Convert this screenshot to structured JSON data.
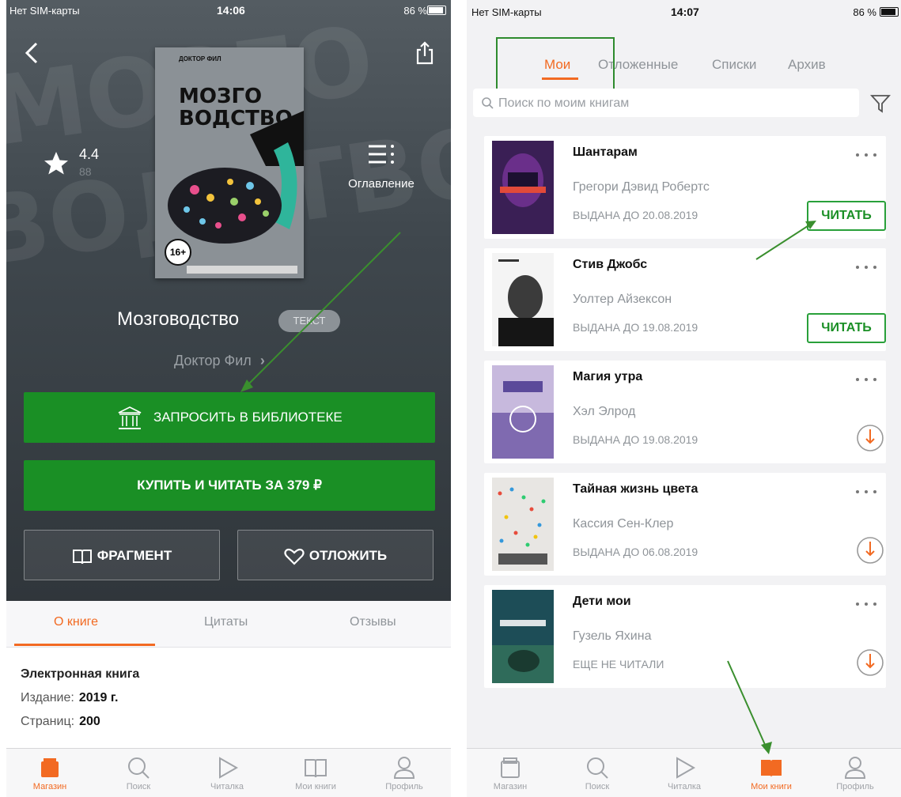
{
  "left": {
    "status": {
      "carrier": "Нет SIM-карты",
      "time": "14:06",
      "battery": "86 %"
    },
    "cover": {
      "top_line": "ДОКТОР ФИЛ",
      "title_line1": "МОЗГО",
      "title_line2": "ВОДСТВО",
      "age": "16+"
    },
    "rating": {
      "value": "4.4",
      "count": "88"
    },
    "toc_label": "Оглавление",
    "book": {
      "title": "Мозговодство",
      "format": "ТЕКСТ",
      "author": "Доктор Фил"
    },
    "buttons": {
      "request": "ЗАПРОСИТЬ В БИБЛИОТЕКЕ",
      "buy": "КУПИТЬ И ЧИТАТЬ ЗА 379 ₽",
      "fragment": "ФРАГМЕНТ",
      "defer": "ОТЛОЖИТЬ"
    },
    "info_tabs": [
      "О книге",
      "Цитаты",
      "Отзывы"
    ],
    "info": {
      "heading": "Электронная книга",
      "edition_label": "Издание:",
      "edition_value": "2019 г.",
      "pages_label": "Страниц:",
      "pages_value": "200"
    },
    "tabbar": [
      "Магазин",
      "Поиск",
      "Читалка",
      "Мои книги",
      "Профиль"
    ],
    "active_tab": "Магазин"
  },
  "right": {
    "status": {
      "carrier": "Нет SIM-карты",
      "time": "14:07",
      "battery": "86 %"
    },
    "tabs": [
      "Мои",
      "Отложенные",
      "Списки",
      "Архив"
    ],
    "active_tab": "Мои книги",
    "search_placeholder": "Поиск по моим книгам",
    "books": [
      {
        "title": "Шантарам",
        "author": "Грегори Дэвид Робертс",
        "status": "ВЫДАНА ДО 20.08.2019",
        "action": "read",
        "action_label": "ЧИТАТЬ"
      },
      {
        "title": "Стив Джобс",
        "author": "Уолтер Айзексон",
        "status": "ВЫДАНА ДО 19.08.2019",
        "action": "read",
        "action_label": "ЧИТАТЬ"
      },
      {
        "title": "Магия утра",
        "author": "Хэл Элрод",
        "status": "ВЫДАНА ДО 19.08.2019",
        "action": "download"
      },
      {
        "title": "Тайная жизнь цвета",
        "author": "Кассия Сен-Клер",
        "status": "ВЫДАНА ДО 06.08.2019",
        "action": "download"
      },
      {
        "title": "Дети мои",
        "author": "Гузель Яхина",
        "status": "ЕЩЕ НЕ ЧИТАЛИ",
        "action": "download"
      }
    ],
    "tabbar": [
      "Магазин",
      "Поиск",
      "Читалка",
      "Мои книги",
      "Профиль"
    ]
  },
  "colors": {
    "accent": "#f26a22",
    "green": "#1a8f25",
    "annotation": "#2e8b2e"
  }
}
